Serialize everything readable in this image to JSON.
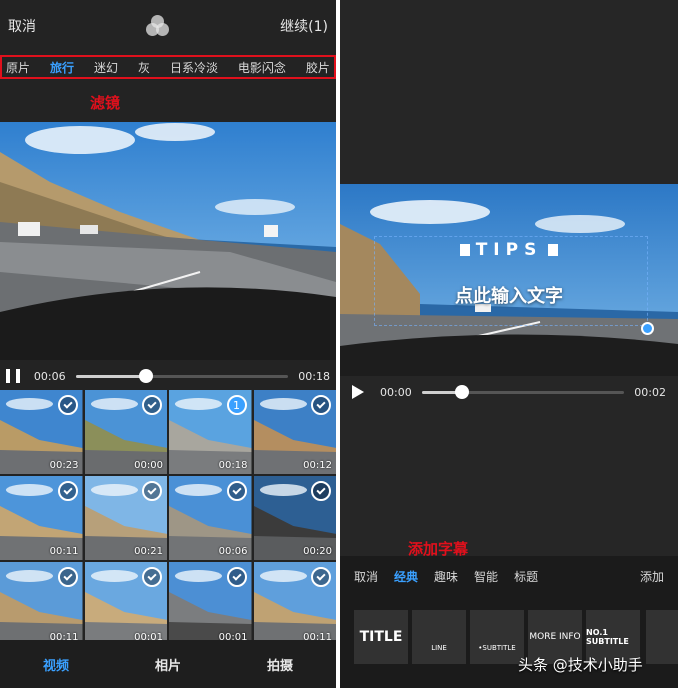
{
  "left_panel": {
    "topbar": {
      "cancel_label": "取消",
      "filter_icon": "filter-circles-icon",
      "continue_label": "继续(1)"
    },
    "filters": [
      "原片",
      "旅行",
      "迷幻",
      "灰",
      "日系冷淡",
      "电影闪念",
      "胶片"
    ],
    "active_filter": "旅行",
    "annotation_label": "滤镜",
    "player": {
      "current_time": "00:06",
      "total_time": "00:18",
      "progress": 0.33
    },
    "thumbnails": [
      {
        "duration": "00:23",
        "selected": "check"
      },
      {
        "duration": "00:00",
        "selected": "check"
      },
      {
        "duration": "00:18",
        "selected": "1"
      },
      {
        "duration": "00:12",
        "selected": "check"
      },
      {
        "duration": "00:11",
        "selected": "check"
      },
      {
        "duration": "00:21",
        "selected": "check"
      },
      {
        "duration": "00:06",
        "selected": "check"
      },
      {
        "duration": "00:20",
        "selected": "check"
      },
      {
        "duration": "00:11",
        "selected": "check"
      },
      {
        "duration": "00:01",
        "selected": "check"
      },
      {
        "duration": "00:01",
        "selected": "check"
      },
      {
        "duration": "00:11",
        "selected": "check"
      }
    ],
    "bottom_tabs": [
      "视频",
      "相片",
      "拍摄"
    ],
    "active_tab": "视频"
  },
  "right_panel": {
    "overlay": {
      "tips_label": "TIPS",
      "enter_text_label": "点此输入文字"
    },
    "player": {
      "current_time": "00:00",
      "total_time": "00:02",
      "progress": 0.2
    },
    "annotation_label": "添加字幕",
    "subtitle_tabs": [
      "取消",
      "经典",
      "趣味",
      "智能",
      "标题"
    ],
    "active_subtitle_tab": "经典",
    "add_label": "添加",
    "style_cards": [
      "TITLE",
      "LINE",
      "•SUBTITLE",
      "MORE INFO",
      "NO.1 SUBTITLE",
      ""
    ],
    "watermark": "头条 @技术小助手"
  },
  "colors": {
    "accent": "#3aa0ff",
    "annotation": "#e0101c",
    "background": "#232323"
  }
}
